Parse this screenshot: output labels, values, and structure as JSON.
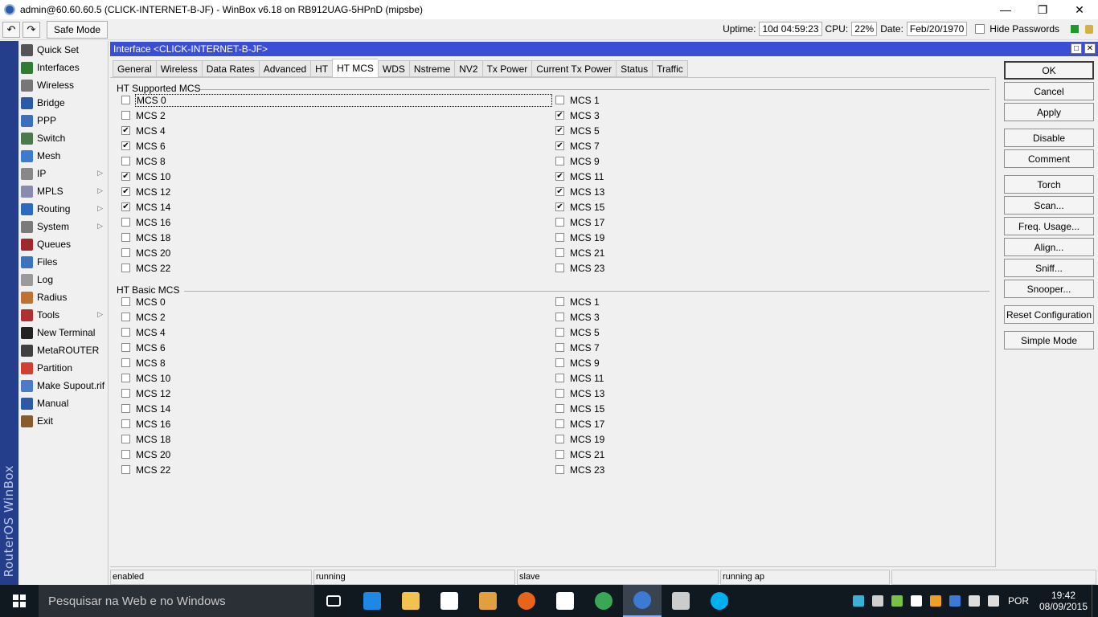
{
  "window": {
    "title": "admin@60.60.60.5 (CLICK-INTERNET-B-JF) - WinBox v6.18 on RB912UAG-5HPnD (mipsbe)"
  },
  "toolbar": {
    "safe_mode": "Safe Mode",
    "uptime_label": "Uptime:",
    "uptime_value": "10d 04:59:23",
    "cpu_label": "CPU:",
    "cpu_value": "22%",
    "date_label": "Date:",
    "date_value": "Feb/20/1970",
    "hide_passwords": "Hide Passwords"
  },
  "brand_vertical": "RouterOS WinBox",
  "sidebar": {
    "items": [
      {
        "label": "Quick Set",
        "icon": "quickset-icon",
        "color": "#555555",
        "arrow": false
      },
      {
        "label": "Interfaces",
        "icon": "interfaces-icon",
        "color": "#2e7d32",
        "arrow": false
      },
      {
        "label": "Wireless",
        "icon": "wireless-icon",
        "color": "#777777",
        "arrow": false
      },
      {
        "label": "Bridge",
        "icon": "bridge-icon",
        "color": "#2a5aa8",
        "arrow": false
      },
      {
        "label": "PPP",
        "icon": "ppp-icon",
        "color": "#3a6fc0",
        "arrow": false
      },
      {
        "label": "Switch",
        "icon": "switch-icon",
        "color": "#4a7a4a",
        "arrow": false
      },
      {
        "label": "Mesh",
        "icon": "mesh-icon",
        "color": "#3b7bd0",
        "arrow": false
      },
      {
        "label": "IP",
        "icon": "ip-icon",
        "color": "#888888",
        "arrow": true
      },
      {
        "label": "MPLS",
        "icon": "mpls-icon",
        "color": "#8a8ab0",
        "arrow": true
      },
      {
        "label": "Routing",
        "icon": "routing-icon",
        "color": "#2a6ac0",
        "arrow": true
      },
      {
        "label": "System",
        "icon": "system-icon",
        "color": "#7a7a7a",
        "arrow": true
      },
      {
        "label": "Queues",
        "icon": "queues-icon",
        "color": "#a0282a",
        "arrow": false
      },
      {
        "label": "Files",
        "icon": "files-icon",
        "color": "#3a74c0",
        "arrow": false
      },
      {
        "label": "Log",
        "icon": "log-icon",
        "color": "#9a9a9a",
        "arrow": false
      },
      {
        "label": "Radius",
        "icon": "radius-icon",
        "color": "#c07030",
        "arrow": false
      },
      {
        "label": "Tools",
        "icon": "tools-icon",
        "color": "#b03030",
        "arrow": true
      },
      {
        "label": "New Terminal",
        "icon": "terminal-icon",
        "color": "#222222",
        "arrow": false
      },
      {
        "label": "MetaROUTER",
        "icon": "metarouter-icon",
        "color": "#404040",
        "arrow": false
      },
      {
        "label": "Partition",
        "icon": "partition-icon",
        "color": "#d04030",
        "arrow": false
      },
      {
        "label": "Make Supout.rif",
        "icon": "supout-icon",
        "color": "#4a7ac8",
        "arrow": false
      },
      {
        "label": "Manual",
        "icon": "manual-icon",
        "color": "#2a5aa8",
        "arrow": false
      },
      {
        "label": "Exit",
        "icon": "exit-icon",
        "color": "#8a5a2a",
        "arrow": false
      }
    ]
  },
  "interface_window": {
    "title": "Interface <CLICK-INTERNET-B-JF>",
    "tabs": [
      {
        "label": "General",
        "active": false
      },
      {
        "label": "Wireless",
        "active": false
      },
      {
        "label": "Data Rates",
        "active": false
      },
      {
        "label": "Advanced",
        "active": false
      },
      {
        "label": "HT",
        "active": false
      },
      {
        "label": "HT MCS",
        "active": true
      },
      {
        "label": "WDS",
        "active": false
      },
      {
        "label": "Nstreme",
        "active": false
      },
      {
        "label": "NV2",
        "active": false
      },
      {
        "label": "Tx Power",
        "active": false
      },
      {
        "label": "Current Tx Power",
        "active": false
      },
      {
        "label": "Status",
        "active": false
      },
      {
        "label": "Traffic",
        "active": false
      }
    ],
    "ht_supported": {
      "heading": "HT Supported MCS",
      "items": [
        {
          "label": "MCS 0",
          "checked": false
        },
        {
          "label": "MCS 1",
          "checked": false
        },
        {
          "label": "MCS 2",
          "checked": false
        },
        {
          "label": "MCS 3",
          "checked": true
        },
        {
          "label": "MCS 4",
          "checked": true
        },
        {
          "label": "MCS 5",
          "checked": true
        },
        {
          "label": "MCS 6",
          "checked": true
        },
        {
          "label": "MCS 7",
          "checked": true
        },
        {
          "label": "MCS 8",
          "checked": false
        },
        {
          "label": "MCS 9",
          "checked": false
        },
        {
          "label": "MCS 10",
          "checked": true
        },
        {
          "label": "MCS 11",
          "checked": true
        },
        {
          "label": "MCS 12",
          "checked": true
        },
        {
          "label": "MCS 13",
          "checked": true
        },
        {
          "label": "MCS 14",
          "checked": true
        },
        {
          "label": "MCS 15",
          "checked": true
        },
        {
          "label": "MCS 16",
          "checked": false
        },
        {
          "label": "MCS 17",
          "checked": false
        },
        {
          "label": "MCS 18",
          "checked": false
        },
        {
          "label": "MCS 19",
          "checked": false
        },
        {
          "label": "MCS 20",
          "checked": false
        },
        {
          "label": "MCS 21",
          "checked": false
        },
        {
          "label": "MCS 22",
          "checked": false
        },
        {
          "label": "MCS 23",
          "checked": false
        }
      ]
    },
    "ht_basic": {
      "heading": "HT Basic MCS",
      "items": [
        {
          "label": "MCS 0",
          "checked": false
        },
        {
          "label": "MCS 1",
          "checked": false
        },
        {
          "label": "MCS 2",
          "checked": false
        },
        {
          "label": "MCS 3",
          "checked": false
        },
        {
          "label": "MCS 4",
          "checked": false
        },
        {
          "label": "MCS 5",
          "checked": false
        },
        {
          "label": "MCS 6",
          "checked": false
        },
        {
          "label": "MCS 7",
          "checked": false
        },
        {
          "label": "MCS 8",
          "checked": false
        },
        {
          "label": "MCS 9",
          "checked": false
        },
        {
          "label": "MCS 10",
          "checked": false
        },
        {
          "label": "MCS 11",
          "checked": false
        },
        {
          "label": "MCS 12",
          "checked": false
        },
        {
          "label": "MCS 13",
          "checked": false
        },
        {
          "label": "MCS 14",
          "checked": false
        },
        {
          "label": "MCS 15",
          "checked": false
        },
        {
          "label": "MCS 16",
          "checked": false
        },
        {
          "label": "MCS 17",
          "checked": false
        },
        {
          "label": "MCS 18",
          "checked": false
        },
        {
          "label": "MCS 19",
          "checked": false
        },
        {
          "label": "MCS 20",
          "checked": false
        },
        {
          "label": "MCS 21",
          "checked": false
        },
        {
          "label": "MCS 22",
          "checked": false
        },
        {
          "label": "MCS 23",
          "checked": false
        }
      ]
    },
    "buttons": [
      "OK",
      "Cancel",
      "Apply",
      "Disable",
      "Comment",
      "Torch",
      "Scan...",
      "Freq. Usage...",
      "Align...",
      "Sniff...",
      "Snooper...",
      "Reset Configuration",
      "Simple Mode"
    ],
    "status": [
      "enabled",
      "running",
      "slave",
      "running ap"
    ]
  },
  "taskbar": {
    "search_placeholder": "Pesquisar na Web e no Windows",
    "language": "POR",
    "time": "19:42",
    "date": "08/09/2015",
    "apps": [
      {
        "name": "task-view-icon",
        "color": "#ffffff"
      },
      {
        "name": "edge-icon",
        "color": "#1e88e5"
      },
      {
        "name": "file-explorer-icon",
        "color": "#f2c14e"
      },
      {
        "name": "store-icon",
        "color": "#ffffff"
      },
      {
        "name": "media-player-icon",
        "color": "#e0a040"
      },
      {
        "name": "firefox-icon",
        "color": "#e8641a"
      },
      {
        "name": "calculator-icon",
        "color": "#ffffff"
      },
      {
        "name": "chrome-icon",
        "color": "#3aa757"
      },
      {
        "name": "winbox-icon",
        "color": "#3c7bd4"
      },
      {
        "name": "terminal-icon",
        "color": "#cccccc"
      },
      {
        "name": "skype-icon",
        "color": "#00aff0"
      }
    ]
  }
}
